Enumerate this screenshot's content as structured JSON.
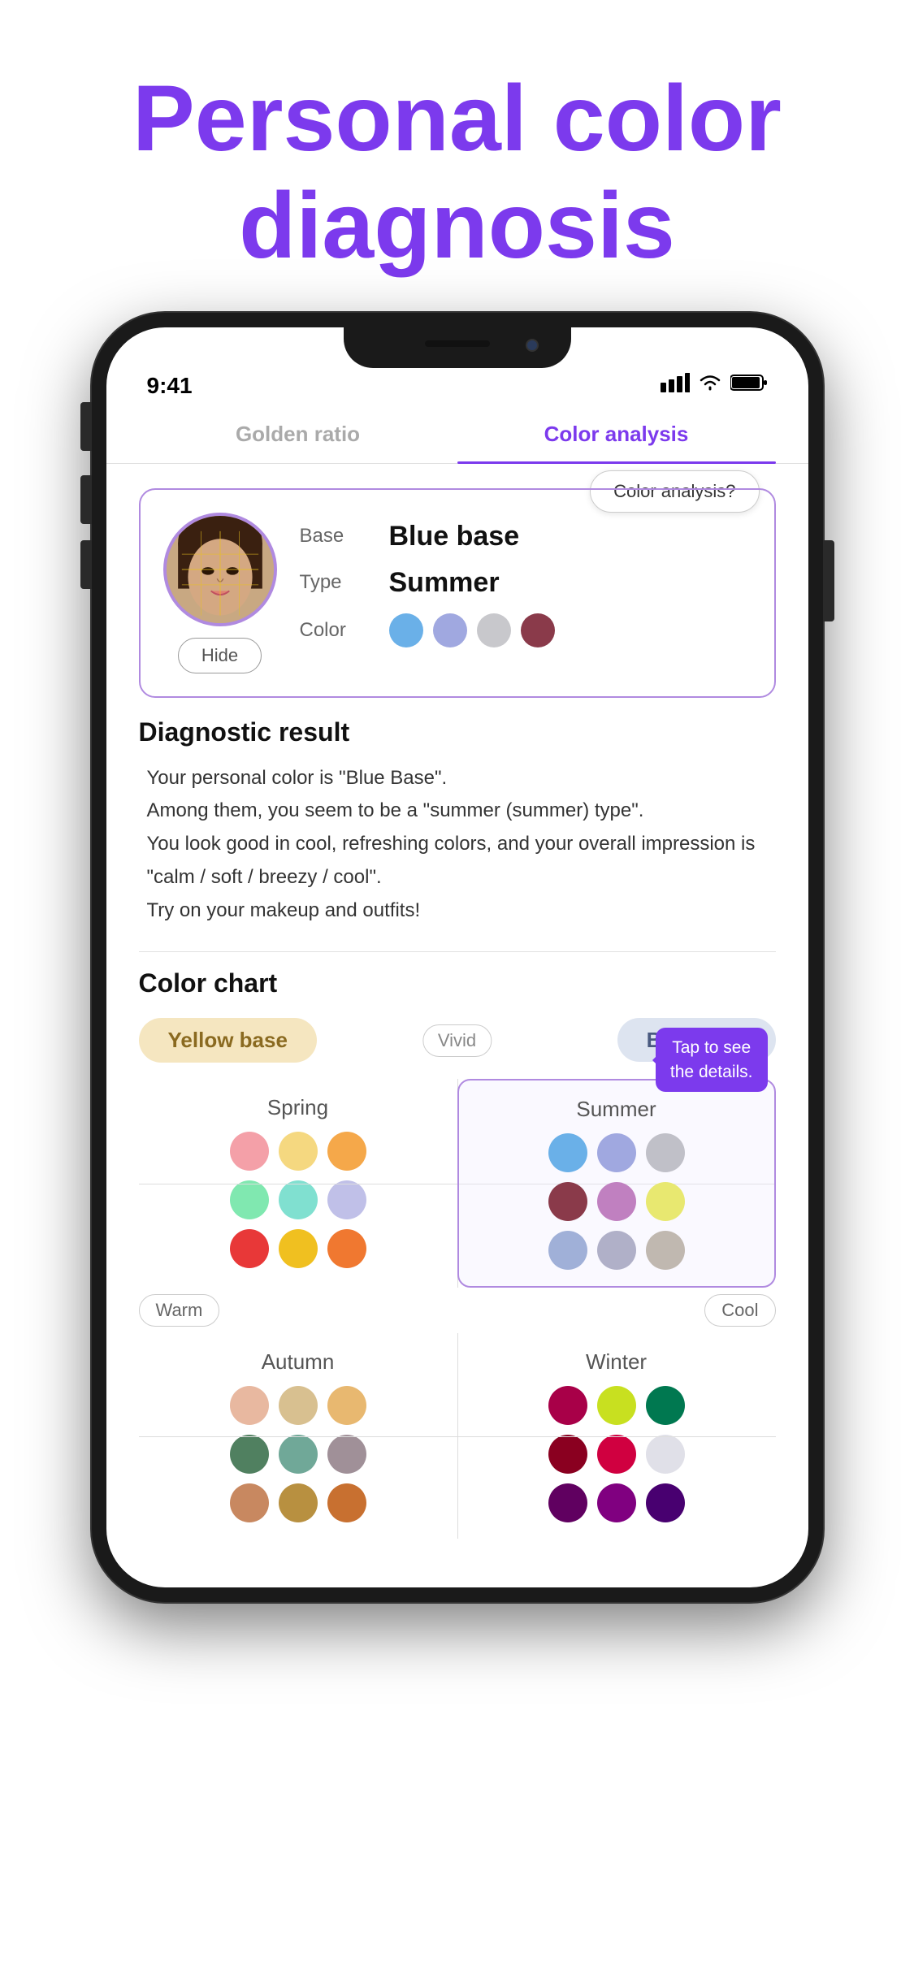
{
  "hero": {
    "line1": "Personal color",
    "line2": "diagnosis"
  },
  "statusBar": {
    "time": "9:41",
    "signal": "▲▲▲▲",
    "wifi": "wifi",
    "battery": "battery"
  },
  "tabs": [
    {
      "label": "Golden ratio",
      "active": false
    },
    {
      "label": "Color analysis",
      "active": true
    }
  ],
  "profileCard": {
    "baseLabel": "Base",
    "baseValue": "Blue base",
    "typeLabel": "Type",
    "typeValue": "Summer",
    "colorLabel": "Color",
    "hideButtonLabel": "Hide",
    "colors": [
      "#6ab0e8",
      "#a0a8e0",
      "#c8c8cc",
      "#8a3a4a"
    ]
  },
  "colorAnalysisButton": "Color analysis?",
  "diagnosticResult": {
    "title": "Diagnostic result",
    "text": "Your personal color is \"Blue Base\".\nAmong them, you seem to be a \"summer (summer) type\".\nYou look good in cool, refreshing colors, and your overall impression is \"calm / soft / breezy / cool\".\nTry on your makeup and outfits!"
  },
  "colorChart": {
    "title": "Color chart",
    "yellowBaseLabel": "Yellow base",
    "blueBaseLabel": "Blue base",
    "vividLabel": "Vivid",
    "warmLabel": "Warm",
    "coolLabel": "Cool",
    "tapTooltip": "Tap to see\nthe details.",
    "seasons": {
      "spring": {
        "name": "Spring",
        "dots": [
          "#f4a0a8",
          "#f5d880",
          "#f5a84a",
          "#80e8b0",
          "#80e0d0",
          "#c0c0e8",
          "#e83838",
          "#f0c020",
          "#f07830"
        ]
      },
      "summer": {
        "name": "Summer",
        "highlighted": true,
        "dots": [
          "#6ab0e8",
          "#a0a8e0",
          "#c0c0c8",
          "#8a3a4a",
          "#c080c0",
          "#e8e870",
          "#a0b0d8",
          "#b0b0c8",
          "#c0b8b0"
        ]
      },
      "autumn": {
        "name": "Autumn",
        "dots": [
          "#e8b8a0",
          "#d8c090",
          "#e8b870",
          "#508060",
          "#70a898",
          "#a09098",
          "#c88860",
          "#b89040",
          "#c87030"
        ]
      },
      "winter": {
        "name": "Winter",
        "dots": [
          "#a80048",
          "#c8e020",
          "#007850",
          "#8a0020",
          "#d00040",
          "#e0e0e8",
          "#600060",
          "#800080",
          "#480070"
        ]
      }
    }
  }
}
